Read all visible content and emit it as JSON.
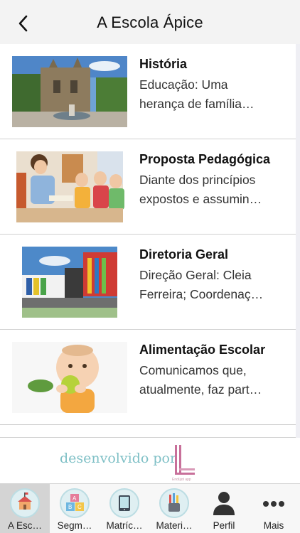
{
  "header": {
    "title": "A Escola Ápice"
  },
  "items": [
    {
      "title": "História",
      "excerpt": [
        "Educação: Uma",
        "herança de família…"
      ],
      "image": "school-building-photo"
    },
    {
      "title": "Proposta Pedagógica",
      "excerpt": [
        "Diante dos princípios",
        "expostos e assumin…"
      ],
      "image": "teacher-reading-children-photo"
    },
    {
      "title": "Diretoria Geral",
      "excerpt": [
        "Direção Geral: Cleia",
        "Ferreira; Coordenaç…"
      ],
      "image": "colorful-school-facade-photo"
    },
    {
      "title": "Alimentação Escolar",
      "excerpt": [
        "Comunicamos que,",
        "atualmente, faz part…"
      ],
      "image": "baby-eating-apple-photo"
    }
  ],
  "footer": {
    "developed_by": "desenvolvido por",
    "logo_small_text": "Endüjot app"
  },
  "tabs": [
    {
      "label": "A Esc…",
      "icon": "school-icon",
      "active": true
    },
    {
      "label": "Segm…",
      "icon": "abc-blocks-icon"
    },
    {
      "label": "Matríc…",
      "icon": "tablet-icon"
    },
    {
      "label": "Materi…",
      "icon": "pencil-cup-icon"
    },
    {
      "label": "Perfil",
      "icon": "person-icon"
    },
    {
      "label": "Mais",
      "icon": "more-dots-icon"
    }
  ],
  "colors": {
    "active_tab_bg": "#d4d4d4",
    "icon_circle": "#dfeff2",
    "footer_text": "#7fc0c6",
    "logo_pink": "#c8709a"
  }
}
